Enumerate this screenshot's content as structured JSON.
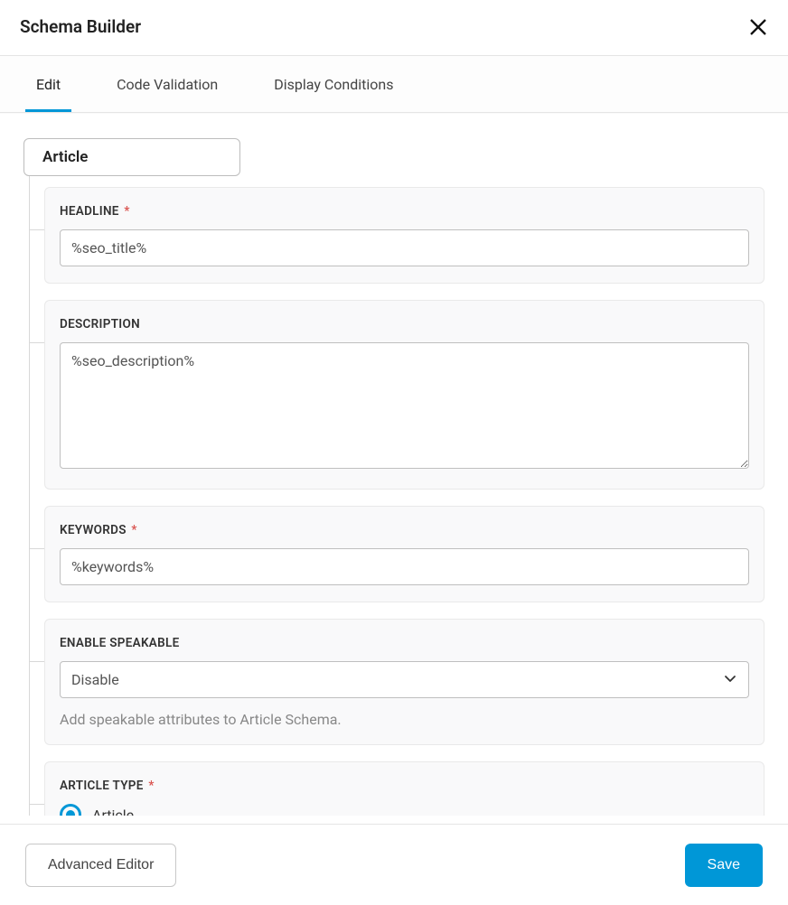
{
  "header": {
    "title": "Schema Builder"
  },
  "tabs": {
    "edit": "Edit",
    "code_validation": "Code Validation",
    "display_conditions": "Display Conditions"
  },
  "schema_type": "Article",
  "fields": {
    "headline": {
      "label": "HEADLINE",
      "required": true,
      "value": "%seo_title%"
    },
    "description": {
      "label": "DESCRIPTION",
      "required": false,
      "value": "%seo_description%"
    },
    "keywords": {
      "label": "KEYWORDS",
      "required": true,
      "value": "%keywords%"
    },
    "speakable": {
      "label": "ENABLE SPEAKABLE",
      "value": "Disable",
      "helper": "Add speakable attributes to Article Schema."
    },
    "article_type": {
      "label": "ARTICLE TYPE",
      "required": true,
      "options": [
        "Article"
      ],
      "selected": "Article"
    }
  },
  "footer": {
    "advanced_editor": "Advanced Editor",
    "save": "Save"
  },
  "required_marker": "*"
}
